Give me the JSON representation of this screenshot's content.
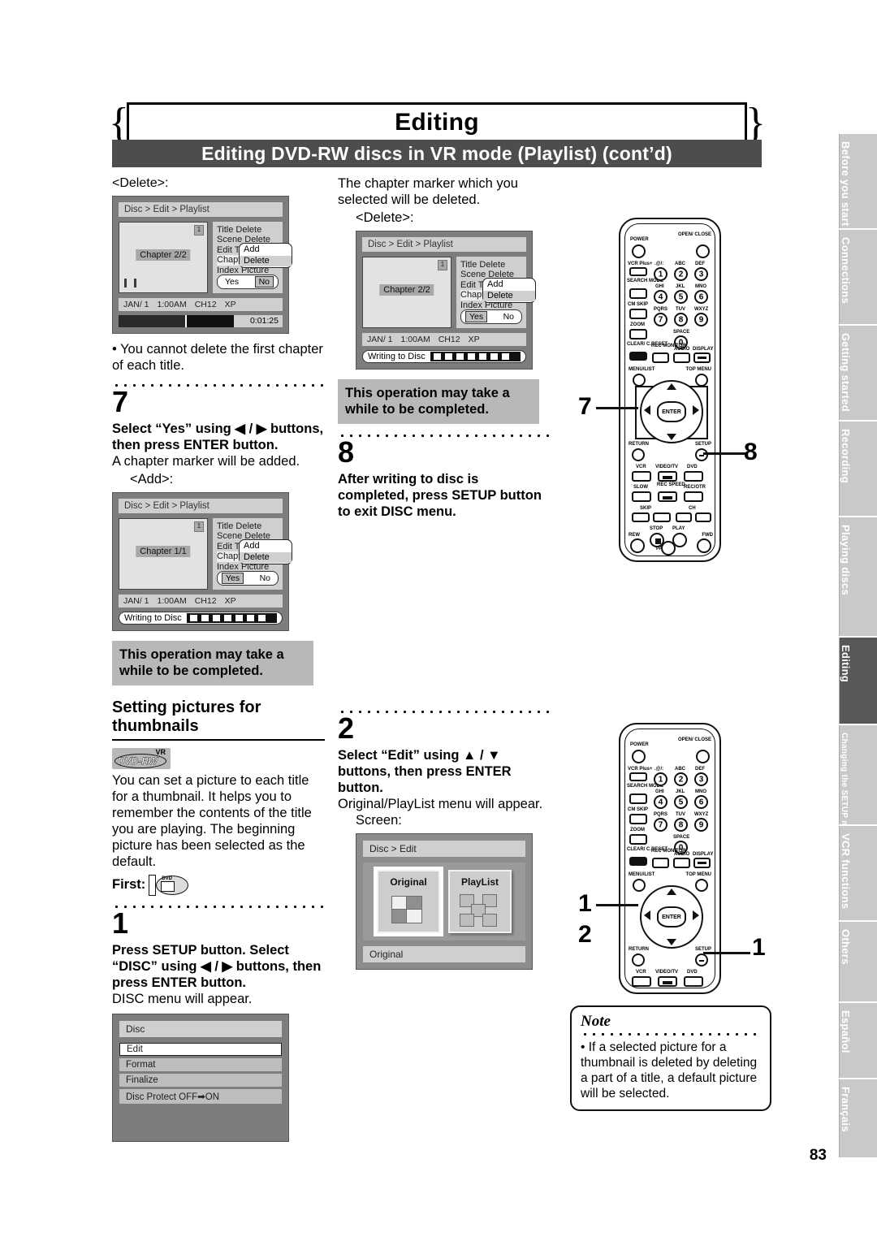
{
  "header": {
    "title": "Editing",
    "subtitle": "Editing DVD-RW discs in VR mode (Playlist) (cont’d)"
  },
  "page_number": "83",
  "col_left": {
    "delete_label": "<Delete>:",
    "screen1": {
      "breadcrumb": "Disc > Edit > Playlist",
      "badge": "1",
      "chapter": "Chapter 2/2",
      "menu": [
        "Title Delete",
        "Scene Delete",
        "Edit Title Name",
        "Chapter Mark",
        "Index Picture"
      ],
      "popup": [
        "Add",
        "Delete"
      ],
      "popup_selected": "Delete",
      "yes": "Yes",
      "no": "No",
      "no_selected": true,
      "info_date": "JAN/ 1",
      "info_time": "1:00AM",
      "info_channel": "CH12",
      "info_mode": "XP",
      "time": "0:01:25"
    },
    "bullet": "• You cannot delete the first chapter of each title.",
    "step7_num": "7",
    "step7_bold": "Select “Yes” using ◀ / ▶ buttons, then press ENTER button.",
    "step7_text": "A chapter marker will be added.",
    "add_label": "<Add>:",
    "screen2": {
      "breadcrumb": "Disc > Edit > Playlist",
      "badge": "1",
      "chapter": "Chapter 1/1",
      "menu": [
        "Title Delete",
        "Scene Delete",
        "Edit Title Name",
        "Chapter Mark",
        "Index Picture"
      ],
      "popup": [
        "Add",
        "Delete"
      ],
      "popup_selected": "Delete",
      "yes": "Yes",
      "no": "No",
      "yes_selected": true,
      "info_date": "JAN/ 1",
      "info_time": "1:00AM",
      "info_channel": "CH12",
      "info_mode": "XP",
      "writing": "Writing to Disc"
    },
    "gray_note": "This operation may take a while to be completed.",
    "section_title": "Setting pictures for thumbnails",
    "logo_vr": "VR",
    "logo_dvdrw": "DVD-RW",
    "intro": "You can set a picture to each title for a thumbnail. It helps you to remember the contents of the title you are playing. The beginning picture has been selected as the default.",
    "first_label": "First:",
    "step1_num": "1",
    "step1_bold": "Press SETUP button. Select “DISC” using ◀ / ▶ buttons, then press ENTER button.",
    "step1_text": "DISC menu will appear.",
    "screen3": {
      "title": "Disc",
      "rows": [
        "Edit",
        "Format",
        "Finalize",
        "Disc Protect OFF➡ON"
      ],
      "selected": "Edit"
    }
  },
  "col_mid": {
    "intro": "The chapter marker which you selected will be deleted.",
    "delete_label": "<Delete>:",
    "screen1": {
      "breadcrumb": "Disc > Edit > Playlist",
      "badge": "1",
      "chapter": "Chapter 2/2",
      "menu": [
        "Title Delete",
        "Scene Delete",
        "Edit Title Name",
        "Chapter Mark",
        "Index Picture"
      ],
      "popup": [
        "Add",
        "Delete"
      ],
      "popup_selected": "Delete",
      "yes": "Yes",
      "no": "No",
      "yes_selected": true,
      "info_date": "JAN/ 1",
      "info_time": "1:00AM",
      "info_channel": "CH12",
      "info_mode": "XP",
      "writing": "Writing to Disc"
    },
    "gray_note": "This operation may take a while to be completed.",
    "step8_num": "8",
    "step8_bold": "After writing to disc is completed, press SETUP button to exit DISC menu.",
    "step2_num": "2",
    "step2_bold": "Select “Edit” using ▲ / ▼ buttons, then press ENTER button.",
    "step2_text": "Original/PlayList menu will appear.",
    "screen_label": "Screen:",
    "screen2": {
      "breadcrumb": "Disc > Edit",
      "tile1": "Original",
      "tile2": "PlayList",
      "selected": "Original",
      "footer": "Original"
    }
  },
  "note": {
    "title": "Note",
    "text": "• If a selected picture for a thumbnail is deleted by deleting a part of a title, a default picture will be selected."
  },
  "callouts": {
    "remote1_left": "7",
    "remote1_right": "8",
    "remote2_left_top": "1",
    "remote2_left_bottom": "2",
    "remote2_right": "1"
  },
  "remote": {
    "power": "POWER",
    "open_close": "OPEN/ CLOSE",
    "vcr_plus": "VCR Plus+",
    "search_mode": "SEARCH MODE",
    "cm_skip": "CM SKIP",
    "zoom": "ZOOM",
    "clear_reset": "CLEAR/ C.RESET",
    "rec_monitor": "REC MONITOR",
    "audio": "AUDIO",
    "display": "DISPLAY",
    "menu_list": "MENU/LIST",
    "top_menu": "TOP MENU",
    "enter": "ENTER",
    "return": "RETURN",
    "setup": "SETUP",
    "vcr": "VCR",
    "video_tv": "VIDEO/TV",
    "dvd": "DVD",
    "slow": "SLOW",
    "rec_speed": "REC SPEED",
    "rec_otr": "REC/OTR",
    "skip": "SKIP",
    "ch": "CH",
    "stop": "STOP",
    "play": "PLAY",
    "rew": "REW",
    "fwd": "FWD",
    "pause": "PAUSE",
    "keys": [
      {
        "n": "1",
        "l": ".@/:"
      },
      {
        "n": "2",
        "l": "ABC"
      },
      {
        "n": "3",
        "l": "DEF"
      },
      {
        "n": "4",
        "l": "GHI"
      },
      {
        "n": "5",
        "l": "JKL"
      },
      {
        "n": "6",
        "l": "MNO"
      },
      {
        "n": "7",
        "l": "PQRS"
      },
      {
        "n": "8",
        "l": "TUV"
      },
      {
        "n": "9",
        "l": "WXYZ"
      },
      {
        "n": "0",
        "l": "SPACE"
      }
    ]
  },
  "sidebar": {
    "tabs": [
      {
        "label": "Before you start",
        "active": false,
        "small": false
      },
      {
        "label": "Connections",
        "active": false,
        "small": false
      },
      {
        "label": "Getting started",
        "active": false,
        "small": false
      },
      {
        "label": "Recording",
        "active": false,
        "small": false
      },
      {
        "label": "Playing discs",
        "active": false,
        "small": false
      },
      {
        "label": "Editing",
        "active": true,
        "small": false
      },
      {
        "label": "Changing the SETUP menu",
        "active": false,
        "small": true
      },
      {
        "label": "VCR functions",
        "active": false,
        "small": false
      },
      {
        "label": "Others",
        "active": false,
        "small": false
      },
      {
        "label": "Español",
        "active": false,
        "small": false
      },
      {
        "label": "Français",
        "active": false,
        "small": false
      }
    ]
  }
}
